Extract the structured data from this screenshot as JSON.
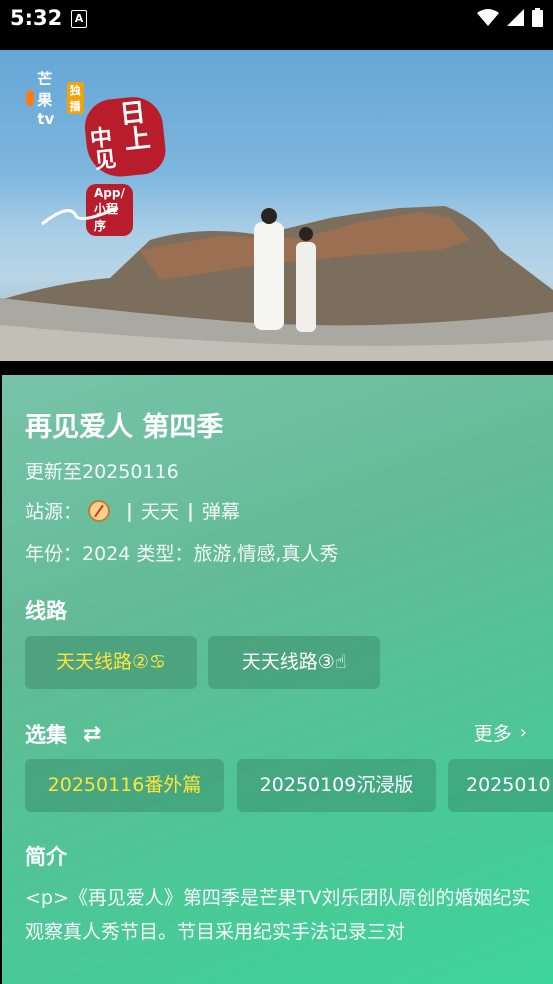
{
  "status_bar": {
    "time": "5:32",
    "notification_letter": "A",
    "icons": [
      "wifi-icon",
      "signal-icon",
      "battery-icon"
    ]
  },
  "video": {
    "platform_logo": "芒果tv",
    "platform_tag": "独播",
    "show_logo_chars": [
      "日",
      "中",
      "上",
      "见"
    ],
    "app_pill": "App/小程序"
  },
  "detail": {
    "title": "再见爱人 第四季",
    "update": "更新至20250116",
    "source_label": "站源：",
    "source_name": "天天",
    "source_extra": "弹幕",
    "separator": "|",
    "year_line": "年份：2024  类型：旅游,情感,真人秀"
  },
  "routes": {
    "label": "线路",
    "items": [
      "天天线路②♋",
      "天天线路③☝"
    ],
    "selected_index": 0
  },
  "episodes": {
    "label": "选集",
    "more_label": "更多",
    "items": [
      "20250116番外篇",
      "20250109沉浸版",
      "2025010"
    ],
    "selected_index": 0
  },
  "intro": {
    "label": "简介",
    "text": "<p>《再见爱人》第四季是芒果TV刘乐团队原创的婚姻纪实观察真人秀节目。节目采用纪实手法记录三对"
  },
  "colors": {
    "panel_start": "#77c3aa",
    "panel_end": "#3dd49a",
    "selected_text": "#ffe53b",
    "status_bar": "#000000"
  }
}
